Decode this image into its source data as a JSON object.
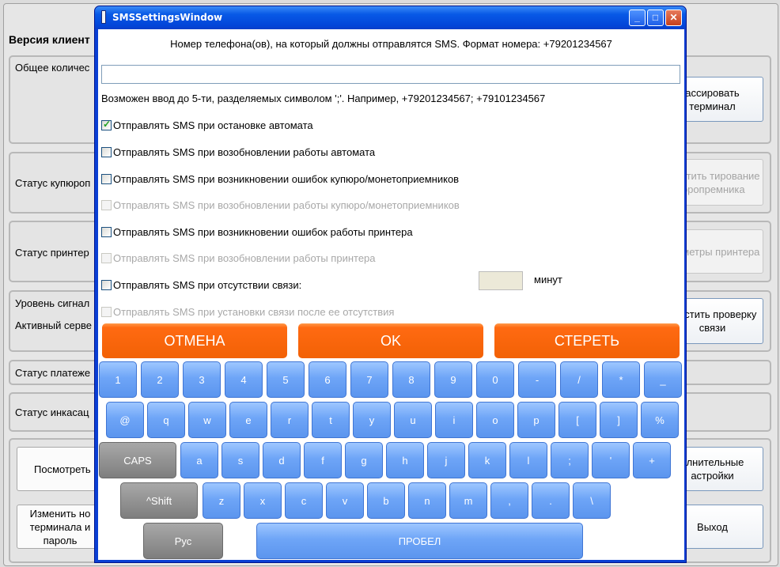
{
  "background": {
    "version_label": "Версия клиент",
    "sections": [
      {
        "label": "Общее количес"
      },
      {
        "label": "Статус купюроп"
      },
      {
        "label": "Статус принтер"
      },
      {
        "label": "Уровень сигнал",
        "label2": "Активный серве"
      },
      {
        "label": "Статус платеже"
      },
      {
        "label": "Статус инкасац"
      }
    ],
    "right_buttons": [
      {
        "label": "ассировать терминал",
        "disabled": false
      },
      {
        "label": "апустить тирование юропремника",
        "disabled": true
      },
      {
        "label": "араметры принтера",
        "disabled": true
      },
      {
        "label": "апустить проверку связи",
        "disabled": false
      },
      {
        "label": "олнительные астройки",
        "disabled": false
      },
      {
        "label": "Выход",
        "disabled": false
      }
    ],
    "left_buttons": [
      {
        "label": "Посмотреть"
      },
      {
        "label": "Изменить но терминала и пароль"
      }
    ]
  },
  "window": {
    "title": "SMSSettingsWindow",
    "controls": {
      "minimize": "_",
      "maximize": "□",
      "close": "✕"
    }
  },
  "form": {
    "phone_hint": "Номер телефона(ов), на который должны отправлятся SMS. Формат номера: +79201234567",
    "phone_value": "",
    "phone_example": "Возможен ввод до 5-ти, разделяемых символом ';'. Например, +79201234567; +79101234567",
    "checkboxes": [
      {
        "label": "Отправлять SMS при остановке автомата",
        "checked": true,
        "enabled": true
      },
      {
        "label": "Отправлять SMS при возобновлении работы автомата",
        "checked": false,
        "enabled": true
      },
      {
        "label": "Отправлять SMS при возникновении ошибок купюро/монетоприемников",
        "checked": false,
        "enabled": true
      },
      {
        "label": "Отправлять SMS при возобновлении работы купюро/монетоприемников",
        "checked": false,
        "enabled": false
      },
      {
        "label": "Отправлять SMS при возникновении ошибок работы принтера",
        "checked": false,
        "enabled": true
      },
      {
        "label": "Отправлять SMS при возобновлении работы принтера",
        "checked": false,
        "enabled": false
      },
      {
        "label": "Отправлять SMS при отсутствии связи:",
        "checked": false,
        "enabled": true
      },
      {
        "label": "Отправлять SMS при установки связи после ее отсутствия",
        "checked": false,
        "enabled": false
      }
    ],
    "minutes_value": "",
    "minutes_label": "минут"
  },
  "actions": {
    "cancel": "ОТМЕНА",
    "ok": "OK",
    "clear": "СТЕРЕТЬ"
  },
  "keyboard": {
    "row1": [
      "1",
      "2",
      "3",
      "4",
      "5",
      "6",
      "7",
      "8",
      "9",
      "0",
      "-",
      "/",
      "*",
      "_"
    ],
    "row2": [
      "@",
      "q",
      "w",
      "e",
      "r",
      "t",
      "y",
      "u",
      "i",
      "o",
      "p",
      "[",
      "]",
      "%"
    ],
    "row3": [
      "CAPS",
      "a",
      "s",
      "d",
      "f",
      "g",
      "h",
      "j",
      "k",
      "l",
      ";",
      "'",
      "+"
    ],
    "row4": [
      "^Shift",
      "z",
      "x",
      "c",
      "v",
      "b",
      "n",
      "m",
      ",",
      ".",
      "\\"
    ],
    "row5": [
      "Рус",
      "ПРОБЕЛ"
    ]
  },
  "colors": {
    "accent_orange": "#f26105",
    "key_blue": "#6ea5f7",
    "title_blue": "#0245d8"
  }
}
